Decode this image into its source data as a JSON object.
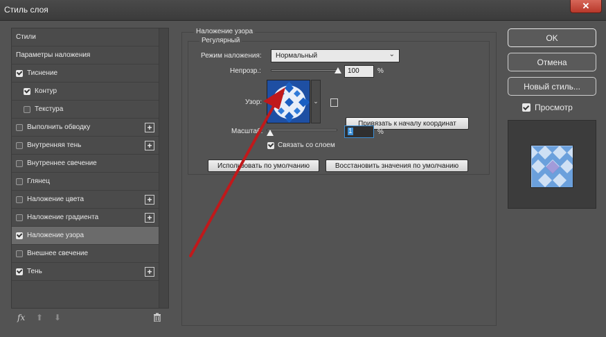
{
  "window": {
    "title": "Стиль слоя",
    "close_glyph": "✕"
  },
  "styles_list": [
    {
      "label": "Стили",
      "checkbox": false,
      "checked": false,
      "plus": false,
      "indent": false,
      "selected": false
    },
    {
      "label": "Параметры наложения",
      "checkbox": false,
      "checked": false,
      "plus": false,
      "indent": false,
      "selected": false
    },
    {
      "label": "Тиснение",
      "checkbox": true,
      "checked": true,
      "plus": false,
      "indent": false,
      "selected": false
    },
    {
      "label": "Контур",
      "checkbox": true,
      "checked": true,
      "plus": false,
      "indent": true,
      "selected": false
    },
    {
      "label": "Текстура",
      "checkbox": true,
      "checked": false,
      "plus": false,
      "indent": true,
      "selected": false
    },
    {
      "label": "Выполнить обводку",
      "checkbox": true,
      "checked": false,
      "plus": true,
      "indent": false,
      "selected": false
    },
    {
      "label": "Внутренняя тень",
      "checkbox": true,
      "checked": false,
      "plus": true,
      "indent": false,
      "selected": false
    },
    {
      "label": "Внутреннее свечение",
      "checkbox": true,
      "checked": false,
      "plus": false,
      "indent": false,
      "selected": false
    },
    {
      "label": "Глянец",
      "checkbox": true,
      "checked": false,
      "plus": false,
      "indent": false,
      "selected": false
    },
    {
      "label": "Наложение цвета",
      "checkbox": true,
      "checked": false,
      "plus": true,
      "indent": false,
      "selected": false
    },
    {
      "label": "Наложение градиента",
      "checkbox": true,
      "checked": false,
      "plus": true,
      "indent": false,
      "selected": false
    },
    {
      "label": "Наложение узора",
      "checkbox": true,
      "checked": true,
      "plus": false,
      "indent": false,
      "selected": true
    },
    {
      "label": "Внешнее свечение",
      "checkbox": true,
      "checked": false,
      "plus": false,
      "indent": false,
      "selected": false
    },
    {
      "label": "Тень",
      "checkbox": true,
      "checked": true,
      "plus": true,
      "indent": false,
      "selected": false
    }
  ],
  "bottom_tools": {
    "fx": "fx",
    "up": "⬆",
    "down": "⬇",
    "trash": "🗑"
  },
  "pattern_overlay": {
    "group_title": "Наложение узора",
    "subgroup_title": "Регулярный",
    "blend_mode_label": "Режим наложения:",
    "blend_mode_value": "Нормальный",
    "opacity_label": "Непрозр.:",
    "opacity_value": "100",
    "opacity_unit": "%",
    "opacity_level": 1.0,
    "pattern_label": "Узор:",
    "snap_button": "Привязать к началу координат",
    "scale_label": "Масштаб:",
    "scale_value": "1",
    "scale_unit": "%",
    "scale_level": 0.0,
    "link_label": "Связать со слоем",
    "default_button": "Использовать по умолчанию",
    "reset_button": "Восстановить значения по умолчанию"
  },
  "right": {
    "ok": "OK",
    "cancel": "Отмена",
    "new_style": "Новый стиль...",
    "preview_label": "Просмотр"
  },
  "colors": {
    "accent_arrow": "#c0191b",
    "focus": "#3b8fd6",
    "pattern_blue": "#1e4fa3"
  }
}
